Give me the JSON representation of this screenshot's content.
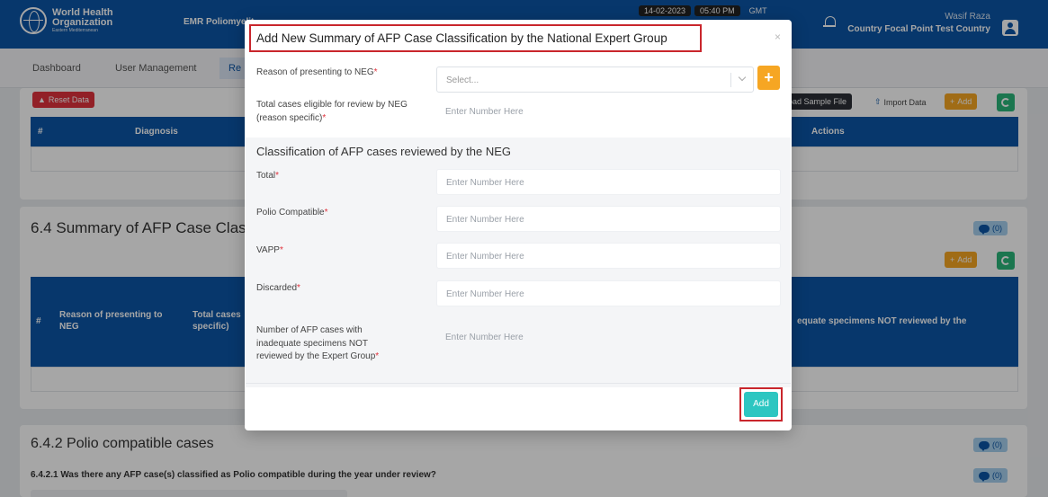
{
  "header": {
    "org_line1": "World Health",
    "org_line2": "Organization",
    "org_line3": "Eastern Mediterranean",
    "app_title": "EMR Poliomyelit",
    "date": "14-02-2023",
    "time": "05:40 PM",
    "tz": "GMT",
    "user_name": "Wasif Raza",
    "user_role": "Country Focal Point Test Country"
  },
  "nav": {
    "items": [
      "Dashboard",
      "User Management",
      "Re"
    ]
  },
  "top_card": {
    "reset_label": "Reset Data",
    "download_label": "oad Sample File",
    "import_label": "Import Data",
    "add_label": "Add",
    "columns": [
      "#",
      "Diagnosis",
      "Actions"
    ]
  },
  "section_64": {
    "title": "6.4 Summary of AFP Case Classi",
    "comments": "(0)",
    "add_label": "Add",
    "columns": [
      "#",
      "Reason of presenting to NEG",
      "Total cases specific)",
      "equate specimens NOT reviewed by the"
    ]
  },
  "section_642": {
    "title": "6.4.2 Polio compatible cases",
    "comments": "(0)",
    "question": "6.4.2.1 Was there any AFP case(s) classified as Polio compatible during the year under review?",
    "question_comments": "(0)"
  },
  "modal": {
    "title": "Add New Summary of AFP Case Classification by the National Expert Group",
    "close": "×",
    "f1_label": "Reason of presenting to NEG",
    "f1_placeholder": "Select...",
    "f2_label": "Total cases eligible for review by NEG (reason specific)",
    "f2_placeholder": "Enter Number Here",
    "section_heading": "Classification of AFP cases reviewed by the NEG",
    "total_label": "Total",
    "polio_label": "Polio Compatible",
    "vapp_label": "VAPP",
    "discarded_label": "Discarded",
    "inadequate_label": "Number of AFP cases with inadequate specimens NOT reviewed by the Expert Group",
    "placeholder": "Enter Number Here",
    "add_button": "Add",
    "plus": "+"
  },
  "colors": {
    "primary": "#0b55a6",
    "accent": "#f6a623",
    "success": "#2ab67a",
    "danger": "#e0323c",
    "teal": "#2cc6c1"
  }
}
